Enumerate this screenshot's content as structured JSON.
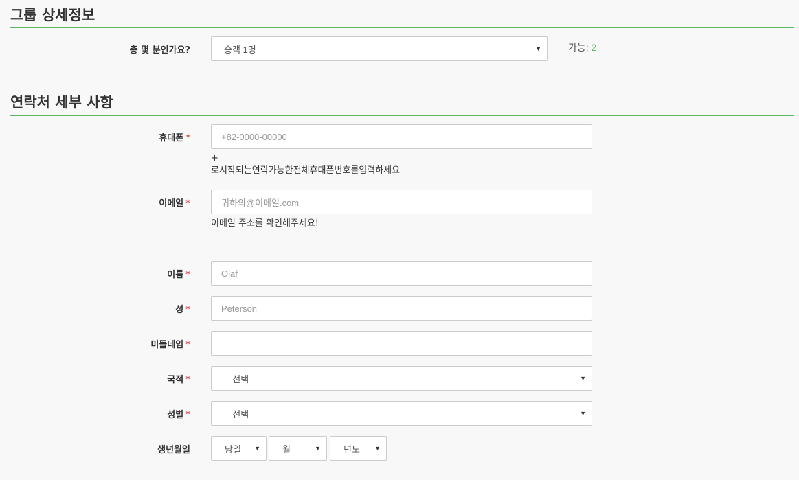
{
  "group_section": {
    "title": "그룹 상세정보",
    "passengers_label": "총 몇 분인가요?",
    "passengers_value": "승객 1명",
    "available_label": "가능:",
    "available_count": "2"
  },
  "contact_section": {
    "title": "연락처 세부 사항",
    "phone": {
      "label": "휴대폰",
      "placeholder": "+82-0000-00000",
      "help_line1": "+",
      "help_line2": "로시작되는연락가능한전체휴대폰번호를입력하세요"
    },
    "email": {
      "label": "이메일",
      "placeholder": "귀하의@이메일.com",
      "help": "이메일 주소를 확인해주세요!"
    },
    "first_name": {
      "label": "이름",
      "placeholder": "Olaf"
    },
    "last_name": {
      "label": "성",
      "placeholder": "Peterson"
    },
    "middle_name": {
      "label": "미들네임",
      "placeholder": ""
    },
    "nationality": {
      "label": "국적",
      "value": "-- 선택 --"
    },
    "gender": {
      "label": "성별",
      "value": "-- 선택 --"
    },
    "birthdate": {
      "label": "생년월일",
      "day": "당일",
      "month": "월",
      "year": "년도"
    },
    "required_mark": "*"
  }
}
